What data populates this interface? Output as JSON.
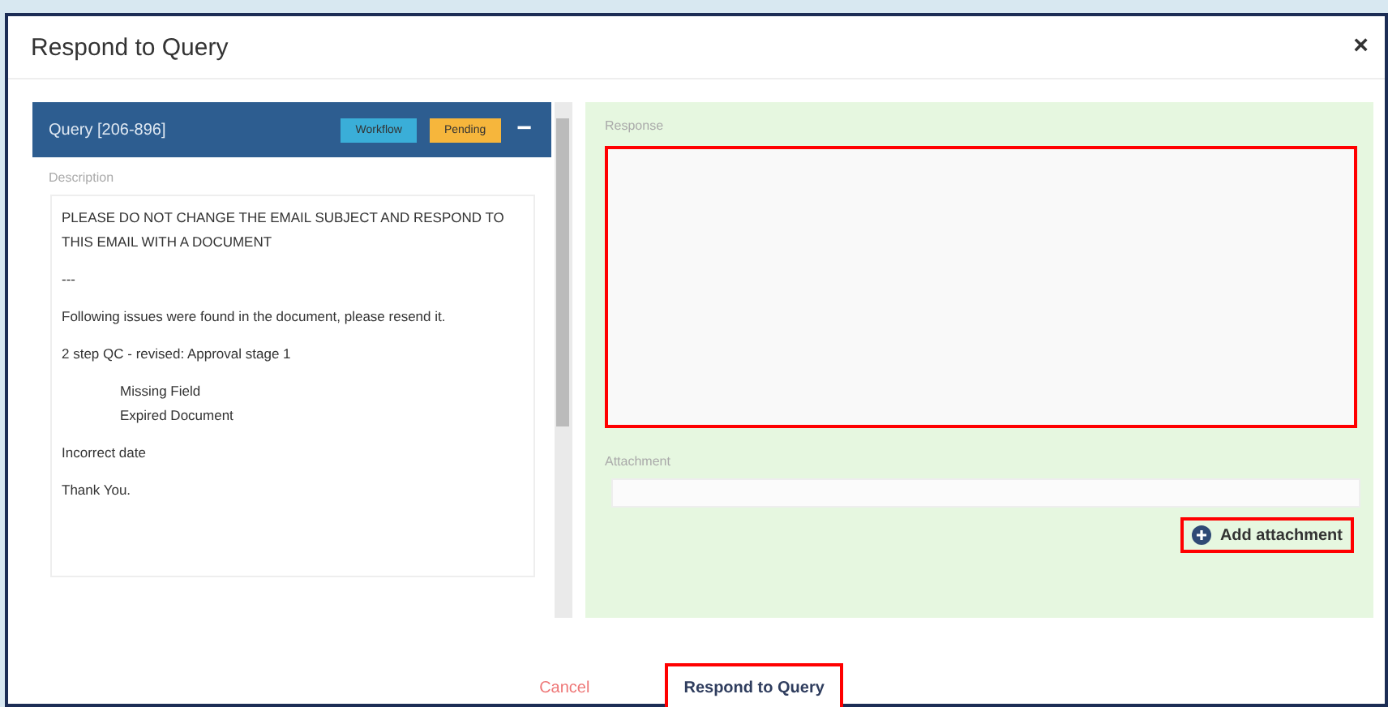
{
  "window": {
    "title": "Respond to Query",
    "close": "×"
  },
  "query": {
    "title": "Query [206-896]",
    "badges": [
      {
        "label": "Workflow",
        "color": "#3aaed8"
      },
      {
        "label": "Pending",
        "color": "#f6b63c"
      }
    ],
    "collapse": "−",
    "description_label": "Description",
    "paragraphs": [
      {
        "text": "PLEASE DO NOT CHANGE THE EMAIL SUBJECT AND RESPOND TO THIS EMAIL WITH A DOCUMENT",
        "indented": false
      },
      {
        "text": "---",
        "indented": false
      },
      {
        "text": "Following issues were found in the document, please resend it.",
        "indented": false
      },
      {
        "text": "2 step QC - revised: Approval stage 1",
        "indented": false
      },
      {
        "text": "Missing Field\nExpired Document",
        "indented": true
      },
      {
        "text": "Incorrect date",
        "indented": false
      },
      {
        "text": "Thank You.",
        "indented": false
      }
    ]
  },
  "response": {
    "label": "Response",
    "highlighted": true
  },
  "attachment": {
    "label": "Attachment",
    "button": "Add attachment",
    "highlighted": true
  },
  "footer": {
    "cancel": "Cancel",
    "submit": "Respond to Query",
    "submit_highlighted": true
  }
}
